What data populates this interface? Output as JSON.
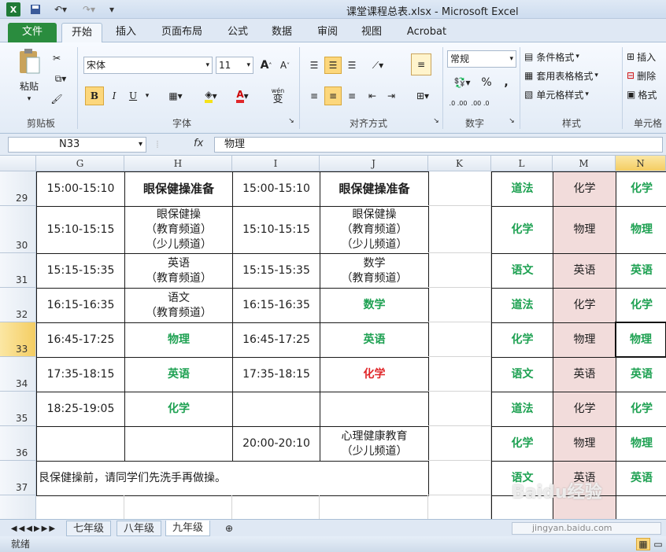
{
  "window": {
    "title": "课堂课程总表.xlsx - Microsoft Excel"
  },
  "tabs": [
    "文件",
    "开始",
    "插入",
    "页面布局",
    "公式",
    "数据",
    "审阅",
    "视图",
    "Acrobat"
  ],
  "ribbon": {
    "paste_label": "粘贴",
    "font_name": "宋体",
    "font_size": "11",
    "bold": "B",
    "italic": "I",
    "underline": "U",
    "font_color_glyph": "A",
    "wen_glyph": "wén",
    "wen_char": "变",
    "number_format": "常规",
    "percent": "%",
    "comma": ",",
    "dec_up": ".0 .00",
    "dec_down": ".00 .0",
    "cond_format": "条件格式",
    "table_format": "套用表格格式",
    "cell_style": "单元格样式",
    "insert": "插入",
    "delete": "删除",
    "format": "格式",
    "groups": {
      "clipboard": "剪贴板",
      "font": "字体",
      "align": "对齐方式",
      "number": "数字",
      "style": "样式",
      "cells": "单元格"
    }
  },
  "formula_bar": {
    "name_box": "N33",
    "fx": "fx",
    "value": "物理"
  },
  "columns": [
    "G",
    "H",
    "I",
    "J",
    "K",
    "L",
    "M",
    "N"
  ],
  "rows": [
    {
      "num": "29",
      "G": "15:00-15:10",
      "H": "眼保健操准备",
      "I": "15:00-15:10",
      "J": "眼保健操准备",
      "K": "",
      "L": "道法",
      "M": "化学",
      "N": "化学"
    },
    {
      "num": "30",
      "G": "15:10-15:15",
      "H": [
        "眼保健操",
        "（教育频道）",
        "（少儿频道）"
      ],
      "I": "15:10-15:15",
      "J": [
        "眼保健操",
        "（教育频道）",
        "（少儿频道）"
      ],
      "K": "",
      "L": "化学",
      "M": "物理",
      "N": "物理"
    },
    {
      "num": "31",
      "G": "15:15-15:35",
      "H": [
        "英语",
        "（教育频道）"
      ],
      "I": "15:15-15:35",
      "J": [
        "数学",
        "（教育频道）"
      ],
      "K": "",
      "L": "语文",
      "M": "英语",
      "N": "英语"
    },
    {
      "num": "32",
      "G": "16:15-16:35",
      "H": [
        "语文",
        "（教育频道）"
      ],
      "I": "16:15-16:35",
      "J": "数学",
      "K": "",
      "L": "道法",
      "M": "化学",
      "N": "化学"
    },
    {
      "num": "33",
      "G": "16:45-17:25",
      "H": "物理",
      "I": "16:45-17:25",
      "J": "英语",
      "K": "",
      "L": "化学",
      "M": "物理",
      "N": "物理"
    },
    {
      "num": "34",
      "G": "17:35-18:15",
      "H": "英语",
      "I": "17:35-18:15",
      "J": "化学",
      "K": "",
      "L": "语文",
      "M": "英语",
      "N": "英语"
    },
    {
      "num": "35",
      "G": "18:25-19:05",
      "H": "化学",
      "I": "",
      "J": "",
      "K": "",
      "L": "道法",
      "M": "化学",
      "N": "化学"
    },
    {
      "num": "36",
      "G": "",
      "H": "",
      "I": "20:00-20:10",
      "J": [
        "心理健康教育",
        "（少儿频道）"
      ],
      "K": "",
      "L": "化学",
      "M": "物理",
      "N": "物理"
    },
    {
      "num": "37",
      "G": "艮保健操前，请同学们先洗手再做操。",
      "L": "语文",
      "M": "英语",
      "N": "英语"
    },
    {
      "num": "",
      "G": "",
      "H": "",
      "I": "",
      "J": "",
      "K": "",
      "L": "",
      "M": "",
      "N": ""
    }
  ],
  "sheets": [
    "七年级",
    "八年级",
    "九年级"
  ],
  "status": "就绪",
  "watermark": "Baidu经验",
  "watermark_url": "jingyan.baidu.com"
}
